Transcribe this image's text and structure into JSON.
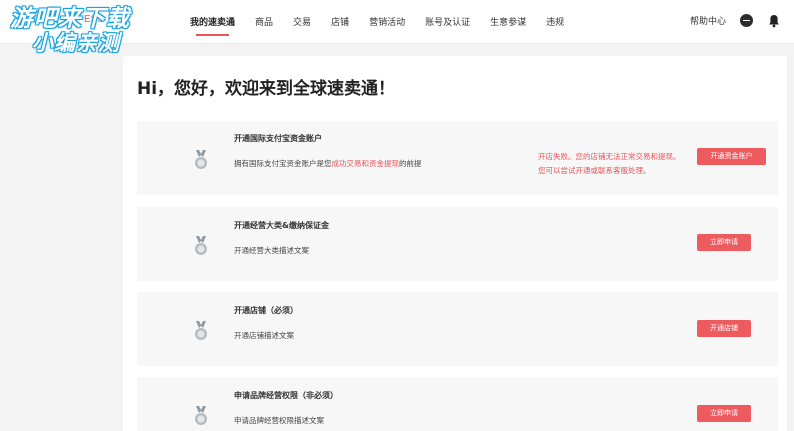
{
  "watermark": {
    "line1": "游吧来下载",
    "line2": "小编亲测"
  },
  "logo_fragment": "ESS",
  "nav": {
    "items": [
      {
        "label": "我的速卖通",
        "active": true
      },
      {
        "label": "商品",
        "active": false
      },
      {
        "label": "交易",
        "active": false
      },
      {
        "label": "店铺",
        "active": false
      },
      {
        "label": "营销活动",
        "active": false
      },
      {
        "label": "账号及认证",
        "active": false
      },
      {
        "label": "生意参谋",
        "active": false
      },
      {
        "label": "违规",
        "active": false
      }
    ],
    "help": "帮助中心",
    "avatar_icon": "avatar-icon",
    "bell_icon": "bell-icon"
  },
  "greeting": "Hi，您好，欢迎来到全球速卖通！",
  "cards": [
    {
      "title": "开通国际支付宝资金账户",
      "desc_parts": [
        "拥有国际支付宝资金账户是您",
        "成功交易和资金提现",
        "的前提"
      ],
      "warning_line1": "开店失败。您的店铺无法正常交易和提现。",
      "warning_line2": "您可以尝试开通或联系客服处理。",
      "button": "开通资金账户",
      "icon": "medal-icon"
    },
    {
      "title": "开通经营大类&缴纳保证金",
      "desc": "开通经营大类描述文案",
      "button": "立即申请",
      "icon": "medal-icon"
    },
    {
      "title": "开通店铺（必须）",
      "desc": "开通店铺描述文案",
      "button": "开通店铺",
      "icon": "medal-icon"
    },
    {
      "title": "申请品牌经营权限（非必须）",
      "desc": "申请品牌经营权限描述文案",
      "button": "立即申请",
      "icon": "medal-icon"
    }
  ],
  "colors": {
    "accent": "#e8545a",
    "button": "#ee5b5f",
    "card_bg": "#f7f7f7",
    "page_bg": "#f3f3f3"
  }
}
